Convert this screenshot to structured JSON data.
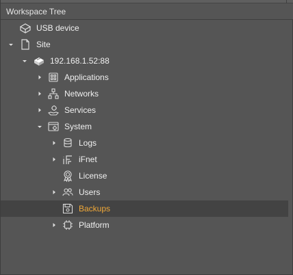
{
  "panel": {
    "title": "Workspace Tree"
  },
  "tree": {
    "usb_device": "USB device",
    "site": "Site",
    "host": "192.168.1.52:88",
    "applications": "Applications",
    "networks": "Networks",
    "services": "Services",
    "system": "System",
    "logs": "Logs",
    "ifnet": "iFnet",
    "license": "License",
    "users": "Users",
    "backups": "Backups",
    "platform": "Platform"
  },
  "selected_item": "backups",
  "colors": {
    "background": "#555555",
    "text": "#f0f0f0",
    "selected_text": "#f0a838",
    "selected_row": "#434343",
    "icon": "#dddddd"
  },
  "icons": {
    "usb_device": "usb-device-icon",
    "site": "document-icon",
    "host": "device-icon",
    "applications": "grid-icon",
    "networks": "network-icon",
    "services": "hand-gear-icon",
    "system": "window-gear-icon",
    "logs": "database-icon",
    "ifnet": "ifnet-icon",
    "license": "badge-icon",
    "users": "users-icon",
    "backups": "floppy-icon",
    "platform": "chip-icon"
  }
}
